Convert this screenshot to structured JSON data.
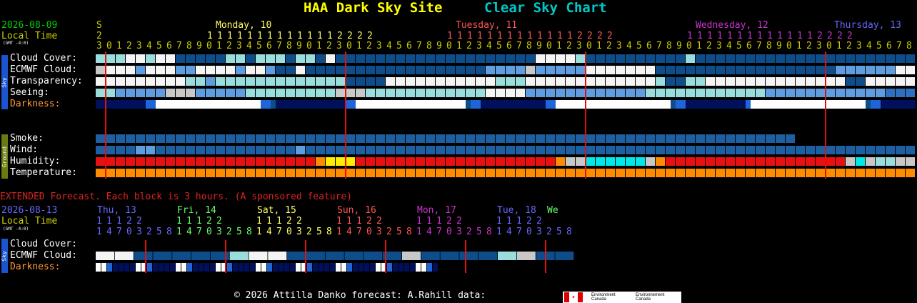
{
  "header": {
    "site": "HAA Dark Sky Site",
    "chart": "Clear Sky Chart",
    "site_color": "#ffff00",
    "chart_color": "#00c8c8"
  },
  "top": {
    "date": "2026-08-09",
    "local_time": "Local Time",
    "gmt": "(GMT -4:0)",
    "start_letter": "S",
    "start_digit": "2",
    "hours": [
      "3",
      "0",
      "1",
      "2",
      "3",
      "4",
      "5",
      "6",
      "7",
      "8",
      "9",
      "0",
      "1",
      "2",
      "3",
      "4",
      "5",
      "6",
      "7",
      "8",
      "9",
      "0",
      "1",
      "2",
      "3",
      "0",
      "1",
      "2",
      "3",
      "4",
      "5",
      "6",
      "7",
      "8",
      "9",
      "0",
      "1",
      "2",
      "3",
      "4",
      "5",
      "6",
      "7",
      "8",
      "9",
      "0",
      "1",
      "2",
      "3",
      "0",
      "1",
      "2",
      "3",
      "4",
      "5",
      "6",
      "7",
      "8",
      "9",
      "0",
      "1",
      "2",
      "3",
      "4",
      "5",
      "6",
      "7",
      "8",
      "9",
      "0",
      "1",
      "2",
      "3",
      "0",
      "1",
      "2",
      "3",
      "4",
      "5",
      "6",
      "7",
      "8",
      "9",
      "0",
      "1",
      "2",
      "3",
      "4",
      "5",
      "6",
      "7",
      "8",
      "9",
      "0",
      "1",
      "2",
      "3",
      "0",
      "1",
      "2",
      "3",
      "4",
      "5",
      "6",
      "7",
      "8"
    ],
    "days": [
      {
        "label": "Monday, 10",
        "color": "#ffff66",
        "tens": "11111111111112222",
        "col": 11
      },
      {
        "label": "Tuesday, 11",
        "color": "#ff5555",
        "tens": "11111111111112222",
        "col": 35
      },
      {
        "label": "Wednesday, 12",
        "color": "#cc33cc",
        "tens": "11111111111112222",
        "col": 59
      },
      {
        "label": "Thursday, 13",
        "color": "#6666ff",
        "tens": "",
        "col": 83
      }
    ],
    "midnight_cols": [
      1,
      25,
      49,
      73
    ]
  },
  "sky_tag": "Sky",
  "ground_tag": "Ground",
  "rows": {
    "cloud": "Cloud Cover:",
    "ecmwf": "ECMWF Cloud:",
    "transparency": "Transparency:",
    "seeing": "Seeing:",
    "darkness": "Darkness:",
    "smoke": "Smoke:",
    "wind": "Wind:",
    "humidity": "Humidity:",
    "temperature": "Temperature:"
  },
  "row_colors": {
    "darkness_label": "#ff9933",
    "local_time_label": "#cccc00",
    "date_label": "#00cc00"
  },
  "chart_data": {
    "type": "heatmap",
    "hourly_rows": {
      "cloud": "mmmwwmwwbbbbbmmbmmmbmmbwbbbbbbbbbbbbbbbbbbbbwwwwmbbbbbbbbbbmbbbbbbbbbbbbbbbbbbbbbbbbbbwwbbwwwbbbbbbbbbbbb",
      "ecmwf": "gwwwlwwwllwwwwlwwlbbwbbbbbbbbbbbbbbbbbbllllglllllwwwwwwwbbbbbbbbbbbbbbbbbbllllllwwwwwwmmmmmmwwwwwwwwbbbbb",
      "transparency": "wwwwwwwwwmmlmmmmmmmmmmmmmbbbbwwwwwwwwwwwmmmwwwwwwwwwwwwwmbbmmwwwwwwwwwwwwwwbbwwwwwwwwwwwwwwwwwwwwwwwww",
      "seeing": "mmlllllggglllllmmmmmmmmmgggmmmmmmmmmmmmwwwwllllllllllllmmmmmmmmmmmmllllllllllllhhhhllllmmmmmmmmmmmwwwwllll",
      "darkness": "nnnnnnnnnnaaYYYYYYYYYYYYYYYYYYYYYaabnnnnnnnnnnnnnnaaYYYYYYYYYYYYYYYYYYYYYYbaannnnnnnnnnnnnaaYYYYYYYYYYYYYYYYYYYYYYYbaannnnnnnnnnnnaYYYYYYYYYYYYYYYYYYYYYYYbaannnnnnnnnnnaYYYYYY",
      "smoke": "dddddddddddddddddddddddddddddddddddddddddddddddddddddddddddddddddddddd",
      "wind": "ddddllddddddddddddddldddddddddddddddddddddddddddddddddddddddddddddddddddddddddddddddddddddddddddddddddd",
      "humidity": "rrrrrrrrrrrrrrrrrrrrrroyyyrrrrrrrrrrrrrrrrrrrroggccccccgorrrrrrrrrrrrrrrrrrgcgmmggcrrrrrrrrrrrrrrrrrrrrrr",
      "temperature": "ooooooooooooooooooooooooooooooooooooooooooooooooooooooooooooooooooooooooooooooooooooooooooooooooooooooooo"
    },
    "palette": {
      "w": "#f4f4f4",
      "m": "#99dddd",
      "b": "#0f4d8a",
      "l": "#5f9de0",
      "g": "#c8c8c8",
      "h": "#2f6fc0",
      "n": "#00105c",
      "a": "#1f64d8",
      "Y": "#ffffff",
      "d": "#1d5fa0",
      "r": "#e81010",
      "o": "#ff8c00",
      "y": "#ffee00",
      "c": "#00e8e8"
    },
    "legend": "none"
  },
  "extended": {
    "note": "EXTENDED Forecast. Each block is 3 hours. (A sponsored feature)",
    "note_color": "#d22",
    "date": "2026-08-13",
    "local_time": "Local Time",
    "gmt": "(GMT -4:0)",
    "days": [
      {
        "label": "Thu, 13",
        "color": "#6666ff",
        "tens": "11122",
        "col": 0
      },
      {
        "label": "Fri, 14",
        "color": "#66ff66",
        "tens": "11122",
        "col": 8
      },
      {
        "label": "Sat, 15",
        "color": "#ffff66",
        "tens": "11122",
        "col": 16
      },
      {
        "label": "Sun, 16",
        "color": "#ff5555",
        "tens": "11122",
        "col": 24
      },
      {
        "label": "Mon, 17",
        "color": "#cc33cc",
        "tens": "11122",
        "col": 32
      },
      {
        "label": "Tue, 18",
        "color": "#6666ff",
        "tens": "11122",
        "col": 40
      },
      {
        "label": "We",
        "color": "#66ff66",
        "tens": "",
        "col": 45
      }
    ],
    "digits": "14703258147032581470325814703258147032581470325814703258",
    "cloud_label": "Cloud Cover:",
    "ecmwf_label": "ECMWF Cloud:",
    "darkness_label": "Darkness:",
    "cloud_row": "",
    "ecmwf_row": "wwbbbbbmwwbbbbbbgbbbbmgbbbbbbbm",
    "darkness_row": "wwaSSYYwwaSSYYwwaSSYYwwaSSYYwwaSSYYwwaSSYYwwaSSYYwwaSSYYwwaS",
    "midnight_cols": [
      5,
      13,
      21,
      29,
      37,
      45
    ]
  },
  "footer": {
    "text": "© 2026 Attilla Danko  forecast: A.Rahill  data:",
    "env_en": "Environment Canada",
    "env_fr": "Environnement Canada"
  }
}
